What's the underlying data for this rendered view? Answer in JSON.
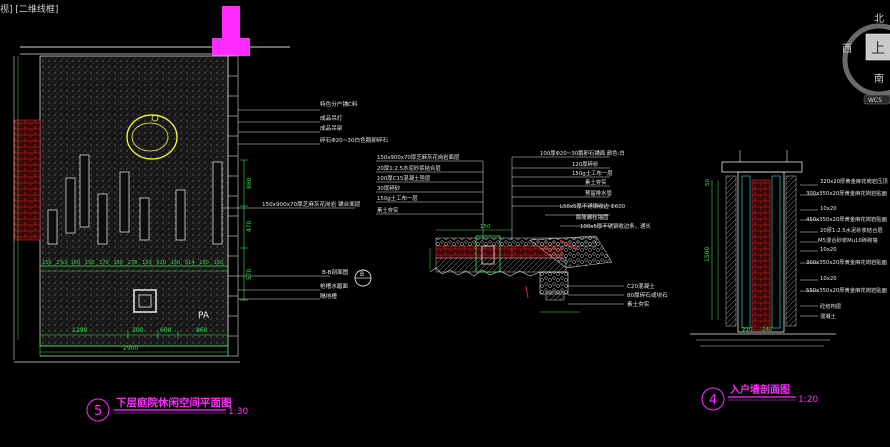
{
  "viewport": {
    "label": "视] [二维线框]"
  },
  "viewcube": {
    "north": "北",
    "south": "南",
    "west": "西",
    "face": "上",
    "wcs": "WCS"
  },
  "plan": {
    "title_number": "5",
    "title": "下层庭院休闲空间平面图",
    "scale": "1:30",
    "notes": [
      "特色分户铺C料",
      "成品吊灯",
      "成品吊架",
      "碎石Φ20~30白色鹅卵碎石",
      "150x900x70厚芝麻灰花岗岩  铺台面层",
      "B-B剖面图",
      "枪槽水磨面",
      "隔地槽"
    ],
    "pa": "PA",
    "section_mark": "B",
    "dims_bottom": [
      "1290",
      "300",
      "600",
      "860"
    ],
    "dim_total": "2900",
    "dims_right": [
      "880",
      "470",
      "570"
    ],
    "dims_row": [
      "150",
      "2%3",
      "150",
      "150",
      "170",
      "150",
      "278",
      "150",
      "520",
      "150",
      "514",
      "150",
      "150"
    ]
  },
  "section_mid": {
    "left_notes": [
      "150x900x70厚芝麻灰花岗岩面层",
      "20厚1:2.5水泥砂浆结合层",
      "100厚C15混凝土垫层",
      "30厚碎砂",
      "150g土工布一层",
      "素土夯实"
    ],
    "right_notes": [
      "100厚Φ20~30鹅卵石铺面  颜色:白",
      "120厚碎砂",
      "150g土工布一层",
      "素土夯实",
      "预留排水管",
      "L50x5厚不锈钢收边 Φ600",
      "膨胀螺栓锚固",
      "100x5厚不锈钢收边条，通长"
    ],
    "bottom_notes": [
      "C20混凝土",
      "80厚碎石或块石",
      "素土夯实"
    ],
    "dim_150": "150"
  },
  "section_wall": {
    "title_number": "4",
    "title": "入户墙剖面图",
    "scale": "1:20",
    "notes": [
      "320x20厚黄金麻花岗岩压顶",
      "300x350x20厚黄金麻花岗岩贴面",
      "10x20",
      "450x350x20厚黄金麻花岗岩贴面",
      "20厚1:2.5水泥砂浆结合层",
      "M5混合砂浆Mu10砖砌墙",
      "10x20",
      "300x350x20厚黄金麻花岗岩贴面",
      "10x20",
      "550x350x20厚黄金麻花岗岩贴面",
      "砼结构层",
      "混凝土"
    ],
    "dims_left": [
      "1500",
      "50"
    ],
    "dims_bottom": [
      "210",
      "240"
    ]
  },
  "colors": {
    "background": "#000000",
    "line_white": "#e8e8e8",
    "line_yellow": "#ffff3a",
    "line_green": "#33e14a",
    "line_cyan": "#33e6e6",
    "magenta": "#ff2cff",
    "red": "#e32222"
  }
}
